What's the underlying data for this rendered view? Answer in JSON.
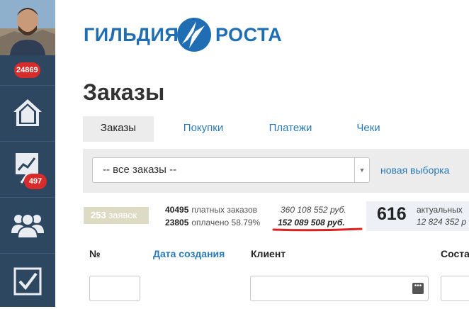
{
  "sidebar": {
    "top_badge": "24869",
    "chart_badge": "497"
  },
  "logo": {
    "left_text": "ГИЛЬДИЯ",
    "right_text": "РОСТА"
  },
  "page_title": "Заказы",
  "tabs": [
    {
      "label": "Заказы",
      "active": true
    },
    {
      "label": "Покупки",
      "active": false
    },
    {
      "label": "Платежи",
      "active": false
    },
    {
      "label": "Чеки",
      "active": false
    }
  ],
  "filter": {
    "select_value": "-- все заказы --",
    "new_selection_label": "новая выборка"
  },
  "stats": {
    "requests_count": "253",
    "requests_label": "заявок",
    "paid_orders_count": "40495",
    "paid_orders_label": "платных заказов",
    "paid_count": "23805",
    "paid_label": "оплачено 58.79%",
    "total_amount": "360 108 552 руб.",
    "paid_amount": "152 089 508 руб.",
    "actual_count": "616",
    "actual_label": "актуальных",
    "actual_amount": "12 824 352 р"
  },
  "table": {
    "columns": [
      "№",
      "Дата создания",
      "Клиент",
      "Соста"
    ]
  },
  "colors": {
    "sidebar_bg": "#2e4761",
    "badge_red": "#d62c2c",
    "link_blue": "#2a7ab8",
    "logo_blue": "#1f6db3",
    "highlight_underline": "#e02020"
  }
}
